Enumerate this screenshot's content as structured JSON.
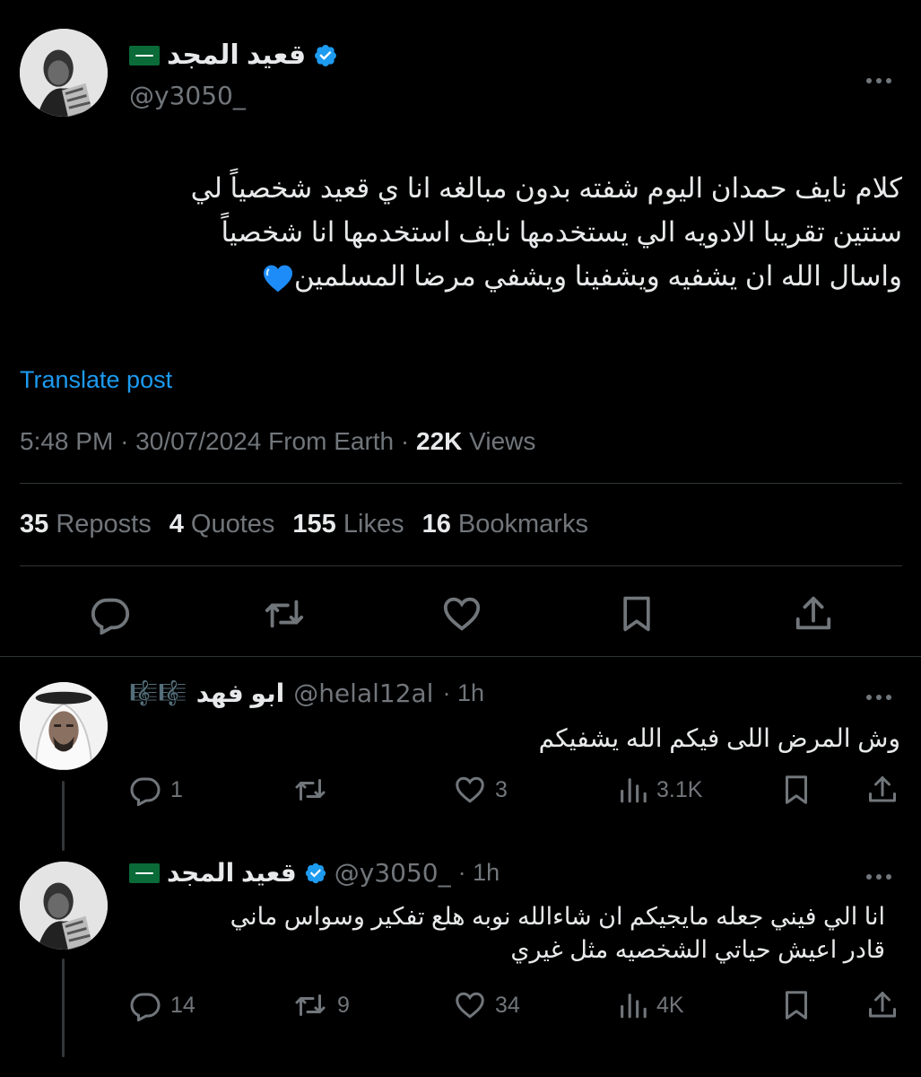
{
  "main_tweet": {
    "author_name": "قعيد المجد",
    "author_handle": "@y3050_",
    "text_lines": [
      "كلام نايف حمدان اليوم شفته بدون مبالغه انا ي قعيد شخصياً لي",
      "سنتين تقريبا الادويه الي يستخدمها نايف استخدمها انا شخصياً",
      "واسال الله ان يشفيه ويشفينا ويشفي مرضا المسلمين"
    ],
    "translate_label": "Translate post",
    "time": "5:48 PM",
    "date": "30/07/2024",
    "source": "From Earth",
    "views_count": "22K",
    "views_label": "Views",
    "stats": {
      "reposts_count": "35",
      "reposts_label": "Reposts",
      "quotes_count": "4",
      "quotes_label": "Quotes",
      "likes_count": "155",
      "likes_label": "Likes",
      "bookmarks_count": "16",
      "bookmarks_label": "Bookmarks"
    }
  },
  "replies": [
    {
      "author_name": "ابو فهد",
      "name_suffix": "🎼🎼",
      "author_handle": "@helal12al",
      "time": "· 1h",
      "text_lines": [
        "وش المرض اللى فيكم الله يشفيكم"
      ],
      "replies": "1",
      "reposts": "",
      "likes": "3",
      "views": "3.1K"
    },
    {
      "author_name": "قعيد المجد",
      "author_handle": "@y3050_",
      "time": "· 1h",
      "text_lines": [
        "انا الي فيني جعله مايجيكم ان شاءالله نوبه هلع تفكير وسواس ماني",
        "قادر اعيش حياتي الشخصيه مثل غيري"
      ],
      "replies": "14",
      "reposts": "9",
      "likes": "34",
      "views": "4K"
    }
  ],
  "colors": {
    "background": "#000000",
    "text": "#e7e9ea",
    "muted": "#71767b",
    "accent": "#1d9bf0",
    "divider": "#2f3336"
  },
  "icons": [
    "verified-badge-icon",
    "saudi-flag-icon",
    "more-icon",
    "reply-icon",
    "repost-icon",
    "like-icon",
    "bookmark-icon",
    "share-icon",
    "views-icon",
    "blue-heart-emoji"
  ]
}
